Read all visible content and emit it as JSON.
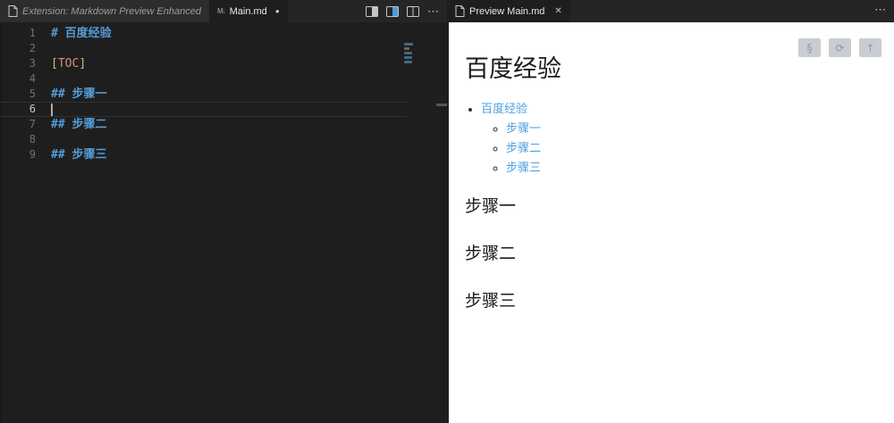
{
  "colors": {
    "accent_blue": "#569cd6",
    "bracket_gold": "#d7ba7d",
    "toc_orange": "#ce9178",
    "link_blue": "#4fa0e0",
    "editor_bg": "#1e1e1e",
    "tab_rail_bg": "#252526",
    "preview_bg": "#ffffff",
    "preview_button_bg": "#c9cdd1"
  },
  "left_group": {
    "tabs": [
      {
        "label": "Extension: Markdown Preview Enhanced"
      },
      {
        "label": "Main.md",
        "md_chip": "M↓",
        "modified_dot": "●"
      }
    ],
    "actions": {
      "more_glyph": "⋯"
    }
  },
  "editor": {
    "lines": [
      {
        "n": "1",
        "tokens": [
          {
            "t": "# 百度经验",
            "c": "#569cd6",
            "b": true
          }
        ]
      },
      {
        "n": "2",
        "tokens": []
      },
      {
        "n": "3",
        "tokens": [
          {
            "t": "[",
            "c": "#d7ba7d"
          },
          {
            "t": "TOC",
            "c": "#ce9178"
          },
          {
            "t": "]",
            "c": "#d7ba7d"
          }
        ]
      },
      {
        "n": "4",
        "tokens": []
      },
      {
        "n": "5",
        "tokens": [
          {
            "t": "## 步骤一",
            "c": "#569cd6",
            "b": true
          }
        ]
      },
      {
        "n": "6",
        "tokens": [],
        "active": true
      },
      {
        "n": "7",
        "tokens": [
          {
            "t": "## 步骤二",
            "c": "#569cd6",
            "b": true
          }
        ]
      },
      {
        "n": "8",
        "tokens": []
      },
      {
        "n": "9",
        "tokens": [
          {
            "t": "## 步骤三",
            "c": "#569cd6",
            "b": true
          }
        ]
      }
    ],
    "minimap": [
      {
        "w": 10,
        "c": "#3e6a88"
      },
      {
        "w": 6,
        "c": "#82614a"
      },
      {
        "w": 9,
        "c": "#3e6a88"
      },
      {
        "w": 9,
        "c": "#3e6a88"
      },
      {
        "w": 9,
        "c": "#3e6a88"
      }
    ]
  },
  "right_group": {
    "tab": {
      "label": "Preview Main.md",
      "close_glyph": "✕"
    },
    "more_glyph": "⋯",
    "toolbar": [
      {
        "name": "section-anchor-button",
        "glyph": "§"
      },
      {
        "name": "refresh-button",
        "glyph": "⟳"
      },
      {
        "name": "back-to-top-button",
        "glyph": "↑"
      }
    ],
    "content": {
      "h1": "百度经验",
      "toc": {
        "root": "百度经验",
        "items": [
          "步骤一",
          "步骤二",
          "步骤三"
        ]
      },
      "sections": [
        "步骤一",
        "步骤二",
        "步骤三"
      ]
    }
  }
}
